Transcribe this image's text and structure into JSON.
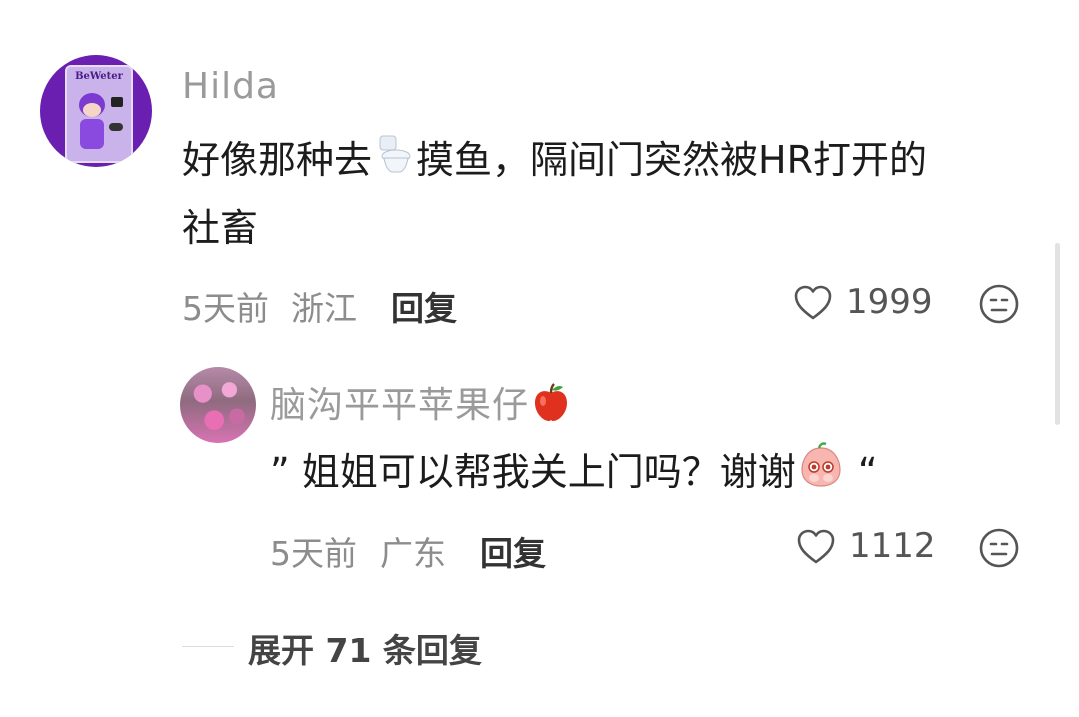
{
  "comment": {
    "author": "Hilda",
    "avatar_text": "BeWeter",
    "text_line1": "好像那种去",
    "toilet_emoji": "🚽",
    "text_line1_rest": "摸鱼，隔间门突然被HR打开的",
    "text_line2": "社畜",
    "time": "5天前",
    "location": "浙江",
    "reply_label": "回复",
    "likes": "1999"
  },
  "reply": {
    "author": "脑沟平平苹果仔",
    "author_emoji": "🍎",
    "text_open": "”",
    "text": "姐姐可以帮我关上门吗？谢谢",
    "text_close": "“",
    "time": "5天前",
    "location": "广东",
    "reply_label": "回复",
    "likes": "1112"
  },
  "expand": {
    "label": "展开 71 条回复"
  }
}
